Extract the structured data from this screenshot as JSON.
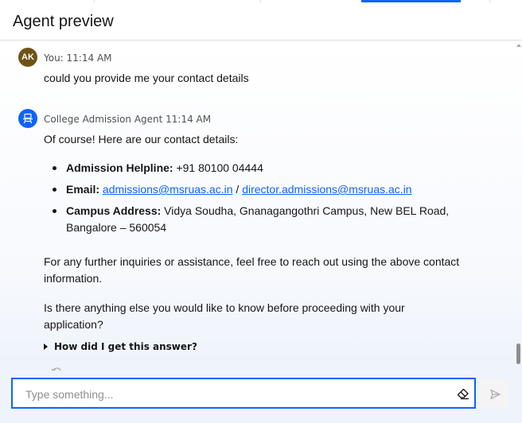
{
  "colors": {
    "accent": "#0f62fe",
    "user_avatar": "#6f5315",
    "agent_avatar": "#0f62fe"
  },
  "header": {
    "title": "Agent preview"
  },
  "messages": [
    {
      "avatar": "AK",
      "meta": "You: 11:14 AM",
      "text": "could you provide me your contact details"
    },
    {
      "avatar_icon": "bot-icon",
      "meta": "College Admission Agent 11:14 AM",
      "intro": "Of course! Here are our contact details:",
      "helpline_label": "Admission Helpline:",
      "helpline_value": " +91 80100 04444",
      "email_label": "Email:",
      "email_1": "admissions@msruas.ac.in",
      "email_sep": " / ",
      "email_2": "director.admissions@msruas.ac.in",
      "address_label": "Campus Address:",
      "address_line1": " Vidya Soudha, Gnanagangothri Campus, New BEL Road,",
      "address_line2": "Bangalore – 560054",
      "para1_line1": "For any further inquiries or assistance, feel free to reach out using the above contact",
      "para1_line2": "information.",
      "para2_line1": "Is there anything else you would like to know before proceeding with your",
      "para2_line2": "application?",
      "explain_label": "How did I get this answer?"
    }
  ],
  "composer": {
    "placeholder": "Type something...",
    "value": ""
  }
}
